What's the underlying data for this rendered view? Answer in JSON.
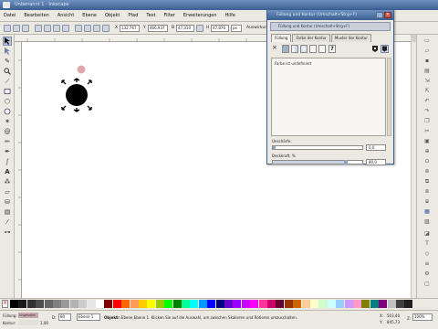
{
  "window": {
    "title": "Unbenannt 1 - Inkscape"
  },
  "menu": [
    "Datei",
    "Bearbeiten",
    "Ansicht",
    "Ebene",
    "Objekt",
    "Pfad",
    "Text",
    "Filter",
    "Erweiterungen",
    "Hilfe"
  ],
  "command_bar": {
    "x_label": "X",
    "x_value": "132,767",
    "y_label": "Y",
    "y_value": "466,937",
    "w_label": "B",
    "w_value": "47,310",
    "h_label": "H",
    "h_value": "47,876",
    "unit": "px",
    "affect_label": "Auswirkung:"
  },
  "canvas": {
    "star_color": "#000000",
    "pointer_color": "#e0a9b2"
  },
  "dialog": {
    "title": "Füllung und Kontur (Umschalt+Strg+F)",
    "subbar": "Füllung und Kontur (Umschalt+Strg+F)",
    "tabs": [
      "Füllung",
      "Farbe der Kontur",
      "Muster der Kontur"
    ],
    "fill_icons": [
      "no-paint-x",
      "flat-color",
      "linear-gradient",
      "radial-gradient",
      "pattern",
      "swatch",
      "unset",
      "evenodd",
      "nonzero"
    ],
    "no_paint_text": "Farbe ist undefiniert",
    "blur_label": "Unschärfe:",
    "blur_value": "0,0",
    "opacity_label": "Deckkraft, %",
    "opacity_value": "80,0"
  },
  "palette_colors": [
    "#000000",
    "#1a1a1a",
    "#333333",
    "#4d4d4d",
    "#666666",
    "#808080",
    "#999999",
    "#b3b3b3",
    "#cccccc",
    "#e6e6e6",
    "#ffffff",
    "#800000",
    "#ff0000",
    "#ff6600",
    "#ff9955",
    "#ffcc00",
    "#ffff00",
    "#99cc00",
    "#00ff00",
    "#008000",
    "#00ff99",
    "#00ffff",
    "#0099ff",
    "#0000ff",
    "#000080",
    "#6600cc",
    "#9900ff",
    "#cc00ff",
    "#ff00ff",
    "#ff3399",
    "#cc0066",
    "#660033",
    "#993300",
    "#cc6600",
    "#ffcc99",
    "#ffffcc",
    "#ccffcc",
    "#ccffff",
    "#99ccff",
    "#cc99ff",
    "#ff99cc",
    "#808000",
    "#008080",
    "#800080",
    "#c0c0c0",
    "#404040",
    "#202020"
  ],
  "status": {
    "fill_label": "Füllung:",
    "stroke_label": "Kontur:",
    "fill_value": "Ungesetzt",
    "stroke_width": "1,00",
    "opacity_label": "D:",
    "opacity_value": "80",
    "layer_label": "Ebene 1",
    "message_bold": "Objekt",
    "message": "in Ebene Ebene 1. Klicken Sie auf die Auswahl, um zwischen Skalieren und Rotieren umzuschalten.",
    "x_label": "X:",
    "x_value": "503,40",
    "y_label": "Y:",
    "y_value": "845,73",
    "zoom_label": "Z:",
    "zoom_value": "100%"
  }
}
